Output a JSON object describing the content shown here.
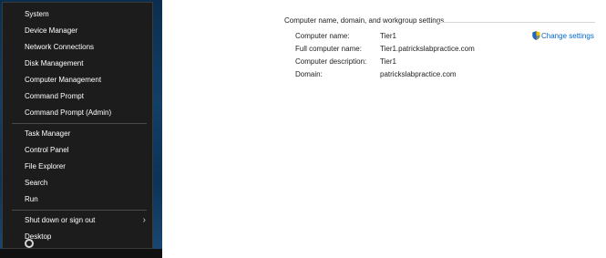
{
  "winx_menu": {
    "items": [
      {
        "label": "System"
      },
      {
        "label": "Device Manager"
      },
      {
        "label": "Network Connections"
      },
      {
        "label": "Disk Management"
      },
      {
        "label": "Computer Management"
      },
      {
        "label": "Command Prompt"
      },
      {
        "label": "Command Prompt (Admin)"
      },
      {
        "label": "Task Manager"
      },
      {
        "label": "Control Panel"
      },
      {
        "label": "File Explorer"
      },
      {
        "label": "Search"
      },
      {
        "label": "Run"
      },
      {
        "label": "Shut down or sign out",
        "submenu_icon": "chevron-right-icon"
      },
      {
        "label": "Desktop"
      }
    ],
    "colors": {
      "background": "#1c1c1c",
      "text": "#ffffff",
      "separator": "#4a4a4a"
    }
  },
  "system_settings": {
    "section_title": "Computer name, domain, and workgroup settings",
    "rows": [
      {
        "label": "Computer name:",
        "value": "Tier1"
      },
      {
        "label": "Full computer name:",
        "value": "Tier1.patrickslabpractice.com"
      },
      {
        "label": "Computer description:",
        "value": "Tier1"
      },
      {
        "label": "Domain:",
        "value": "patrickslabpractice.com"
      }
    ],
    "change_link": {
      "label": "Change settings",
      "icon": "uac-shield-icon",
      "color": "#0066cc"
    }
  }
}
